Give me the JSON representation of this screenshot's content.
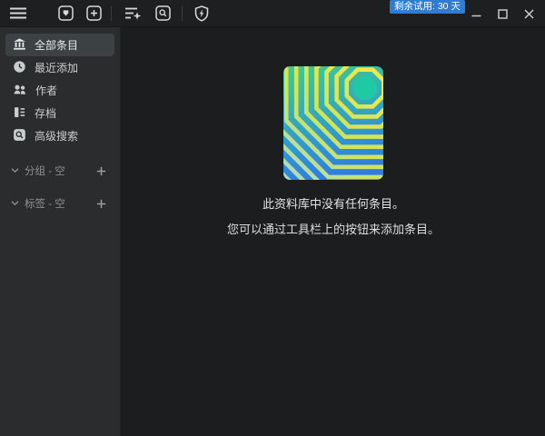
{
  "titlebar": {
    "trial_badge": "剩余试用: 30 天",
    "toolbar_icons": [
      {
        "name": "hamburger-menu-icon"
      },
      {
        "name": "import-item-icon"
      },
      {
        "name": "add-item-icon"
      },
      {
        "name": "smart-list-star-icon"
      },
      {
        "name": "search-icon"
      },
      {
        "name": "license-shield-icon"
      }
    ],
    "window_controls": [
      {
        "name": "minimize-icon"
      },
      {
        "name": "maximize-icon"
      },
      {
        "name": "close-icon"
      }
    ]
  },
  "sidebar": {
    "items": [
      {
        "icon": "library-building-icon",
        "label": "全部条目",
        "selected": true
      },
      {
        "icon": "clock-icon",
        "label": "最近添加",
        "selected": false
      },
      {
        "icon": "authors-people-icon",
        "label": "作者",
        "selected": false
      },
      {
        "icon": "archive-icon",
        "label": "存档",
        "selected": false
      },
      {
        "icon": "advanced-search-icon",
        "label": "高级搜索",
        "selected": false
      }
    ],
    "sections": [
      {
        "icon": "chevron-down-icon",
        "label": "分组 - 空",
        "action_icon": "plus-icon"
      },
      {
        "icon": "chevron-down-icon",
        "label": "标签 - 空",
        "action_icon": "plus-icon"
      }
    ]
  },
  "main": {
    "empty_state": {
      "artwork": "geometric-gradient-artwork",
      "title": "此资料库中没有任何条目。",
      "subtitle": "您可以通过工具栏上的按钮来添加条目。"
    }
  },
  "colors": {
    "accent_blue": "#2f7dd3",
    "topbar_bg": "#1d1f20",
    "sidebar_bg": "#2a2c2d",
    "main_bg": "#1b1d1e",
    "selected_item_bg": "#3c4144",
    "artwork_teal": "#20c9a6",
    "artwork_yellow": "#f0e94a",
    "artwork_blue": "#2e7be2",
    "artwork_green": "#3fc98e"
  }
}
